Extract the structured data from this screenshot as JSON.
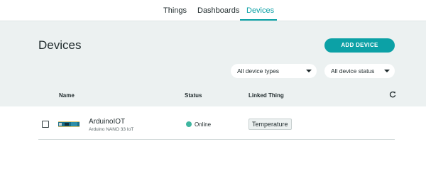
{
  "nav": {
    "tabs": [
      {
        "label": "Things"
      },
      {
        "label": "Dashboards"
      },
      {
        "label": "Devices"
      }
    ],
    "active": "Devices"
  },
  "header": {
    "title": "Devices",
    "add_button": "ADD DEVICE",
    "filters": {
      "device_type": "All device types",
      "device_status": "All device status"
    }
  },
  "table": {
    "columns": [
      "Name",
      "Status",
      "Linked Thing"
    ],
    "refresh_icon": "refresh-icon",
    "rows": [
      {
        "name": "ArduinoIOT",
        "type": "Arduino NANO 33 IoT",
        "status": "Online",
        "linked_thing": "Temperature",
        "board_icon": "board-icon"
      }
    ]
  },
  "colors": {
    "accent": "#0ca1a6",
    "header_bg": "#ecf1f1",
    "online": "#3fb6a0"
  }
}
